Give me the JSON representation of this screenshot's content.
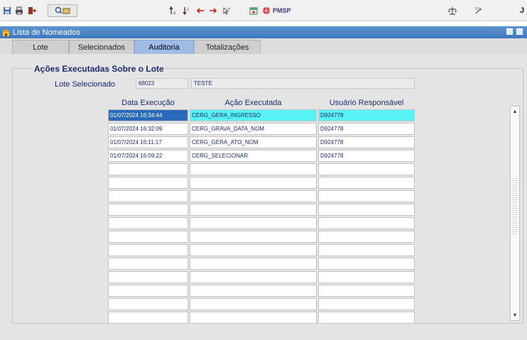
{
  "toolbar": {
    "pmsp_label": "PMSP",
    "icons": [
      "save-icon",
      "print-icon",
      "exit-icon",
      "query-icon",
      "sort-up-icon",
      "sort-down-icon",
      "arrow-left-icon",
      "arrow-right-icon",
      "help-icon",
      "calendar-icon",
      "globe-icon",
      "scale-icon",
      "tools-icon",
      "j-icon"
    ]
  },
  "window": {
    "title": "Lista de Nomeados"
  },
  "tabs": [
    {
      "label": "Lote"
    },
    {
      "label": "Selecionados"
    },
    {
      "label": "Auditoria"
    },
    {
      "label": "Totalizações"
    }
  ],
  "active_tab": "Auditoria",
  "group": {
    "title": "Ações Executadas Sobre o Lote",
    "lote_label": "Lote Selecionado",
    "lote_value": "68023",
    "lote_desc": "TESTE"
  },
  "table": {
    "columns": [
      "Data Execução",
      "Ação Executada",
      "Usuário Responsável"
    ],
    "rows": [
      [
        "01/07/2024 16:34:44",
        "CERG_GERA_INGRESSO",
        "D924778"
      ],
      [
        "01/07/2024 16:32:09",
        "CERG_GRAVA_DATA_NOM",
        "D924778"
      ],
      [
        "01/07/2024 16:11:17",
        "CERG_GERA_ATO_NOM",
        "D924778"
      ],
      [
        "01/07/2024 16:09:22",
        "CERG_SELECIONAR",
        "D924778"
      ],
      [
        "",
        "",
        ""
      ],
      [
        "",
        "",
        ""
      ],
      [
        "",
        "",
        ""
      ],
      [
        "",
        "",
        ""
      ],
      [
        "",
        "",
        ""
      ],
      [
        "",
        "",
        ""
      ],
      [
        "",
        "",
        ""
      ],
      [
        "",
        "",
        ""
      ],
      [
        "",
        "",
        ""
      ],
      [
        "",
        "",
        ""
      ],
      [
        "",
        "",
        ""
      ],
      [
        "",
        "",
        ""
      ]
    ],
    "selected_row": 0
  },
  "colors": {
    "selection_cyan": "#58f2f4",
    "selection_blue": "#2a6ab8",
    "active_tab": "#9fbbe6",
    "titlebar": "#3e78bd",
    "label_text": "#1c2c6a"
  }
}
